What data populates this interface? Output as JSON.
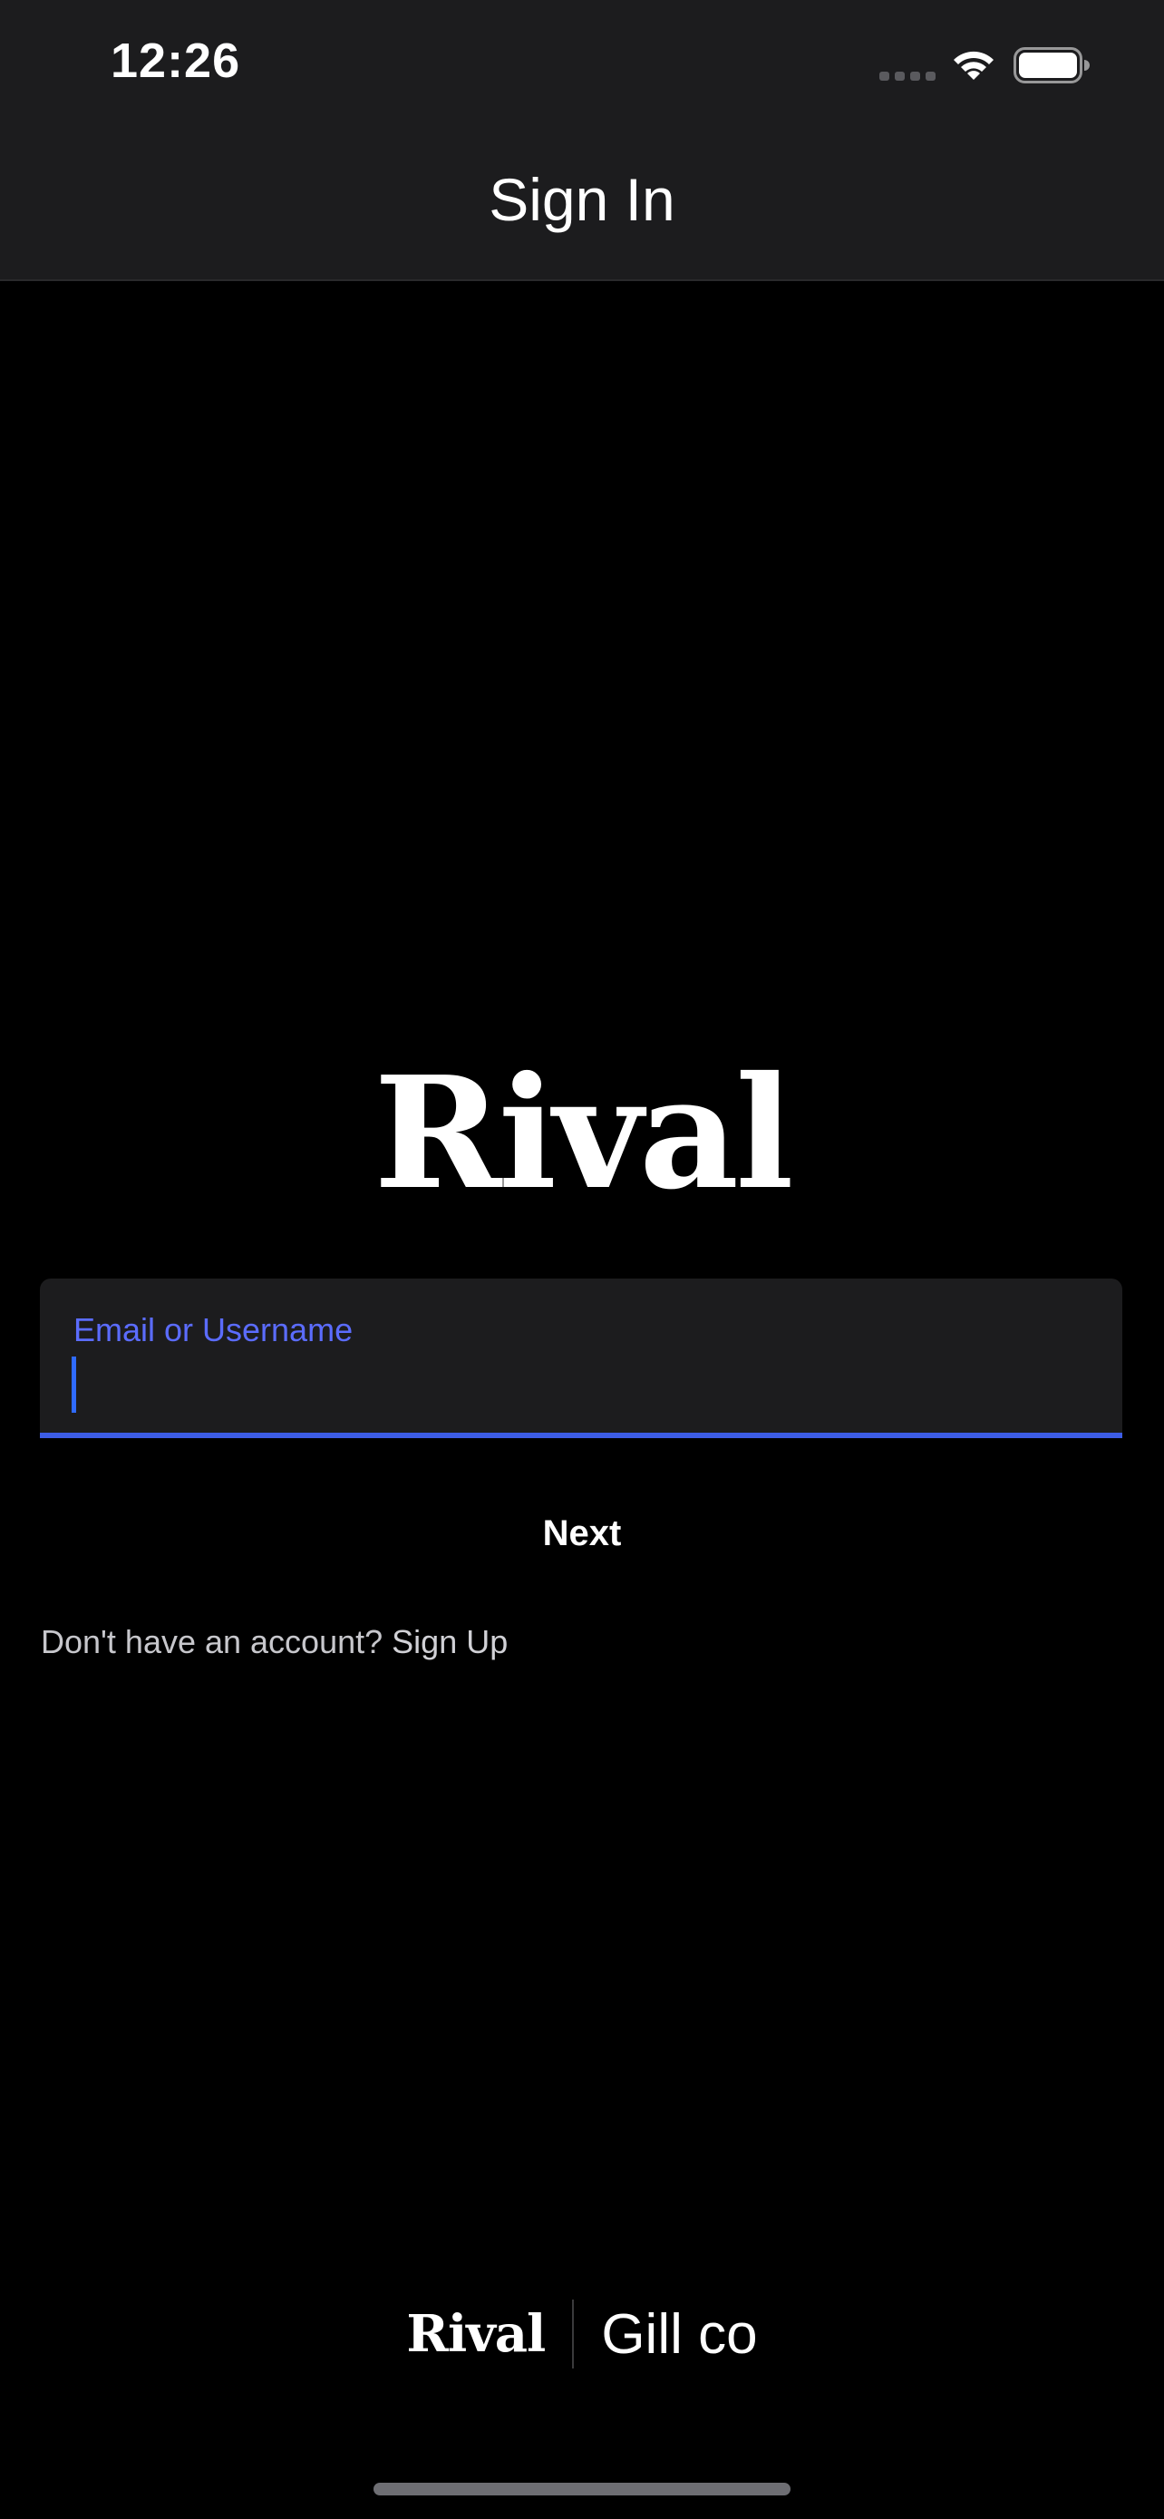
{
  "status_bar": {
    "time": "12:26",
    "icons": [
      "signal-icon",
      "wifi-icon",
      "battery-icon"
    ]
  },
  "nav": {
    "title": "Sign In"
  },
  "logo": {
    "text": "Rival"
  },
  "login_form": {
    "field_label": "Email or Username",
    "field_value": "",
    "next_label": "Next",
    "signup_prompt": "Don't have an account?",
    "signup_link": "Sign Up"
  },
  "footer": {
    "brand": "Rival",
    "partner": "Gill co"
  },
  "colors": {
    "background": "#000000",
    "bar": "#1c1c1e",
    "accent": "#3d5de6",
    "label": "#5b6cff"
  }
}
